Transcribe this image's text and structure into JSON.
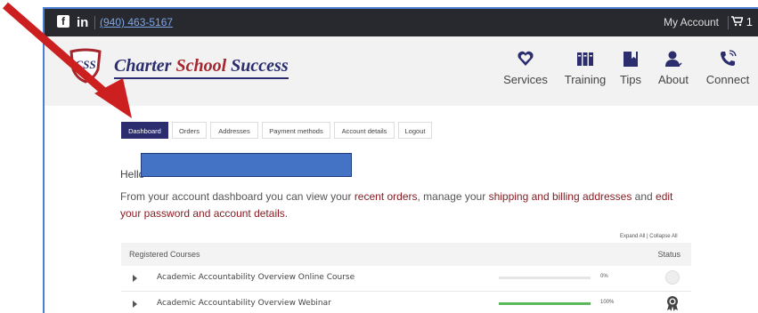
{
  "topbar": {
    "facebook_icon": "facebook-icon",
    "linkedin_glyph": "in",
    "phone": "(940) 463-5167",
    "my_account": "My Account",
    "cart_count": "1"
  },
  "brand": {
    "logo_text": "CSS",
    "name_part1": "Charter ",
    "name_part2": "School",
    "name_part3": " Success",
    "colors": {
      "navy": "#2b2d6e",
      "red": "#a6262d"
    }
  },
  "nav": [
    {
      "label": "Services",
      "icon": "heart-shield-icon"
    },
    {
      "label": "Training",
      "icon": "books-icon"
    },
    {
      "label": "Tips",
      "icon": "bookmark-icon"
    },
    {
      "label": "About",
      "icon": "person-icon"
    },
    {
      "label": "Connect",
      "icon": "phone-icon"
    }
  ],
  "tabs": [
    {
      "label": "Dashboard",
      "active": true
    },
    {
      "label": "Orders"
    },
    {
      "label": "Addresses"
    },
    {
      "label": "Payment methods"
    },
    {
      "label": "Account details"
    },
    {
      "label": "Logout"
    }
  ],
  "greeting": "Hello",
  "intro": {
    "t1": "From your account dashboard you can view your ",
    "l1": "recent orders",
    "t2": ", manage your ",
    "l2": "shipping and billing addresses",
    "t3": " and ",
    "l3": "edit your password and account details",
    "t4": "."
  },
  "courses": {
    "expand_all": "Expand All",
    "divider": " | ",
    "collapse_all": "Collapse All",
    "header_title": "Registered Courses",
    "header_status": "Status",
    "rows": [
      {
        "name": "Academic Accountability Overview Online Course",
        "progress": 0,
        "progress_label": "0%",
        "status_icon": "incomplete-circle-icon"
      },
      {
        "name": "Academic Accountability Overview Webinar",
        "progress": 100,
        "progress_label": "100%",
        "status_icon": "award-ribbon-icon"
      }
    ]
  },
  "annotation": {
    "arrow_color": "#cc1f1f"
  }
}
